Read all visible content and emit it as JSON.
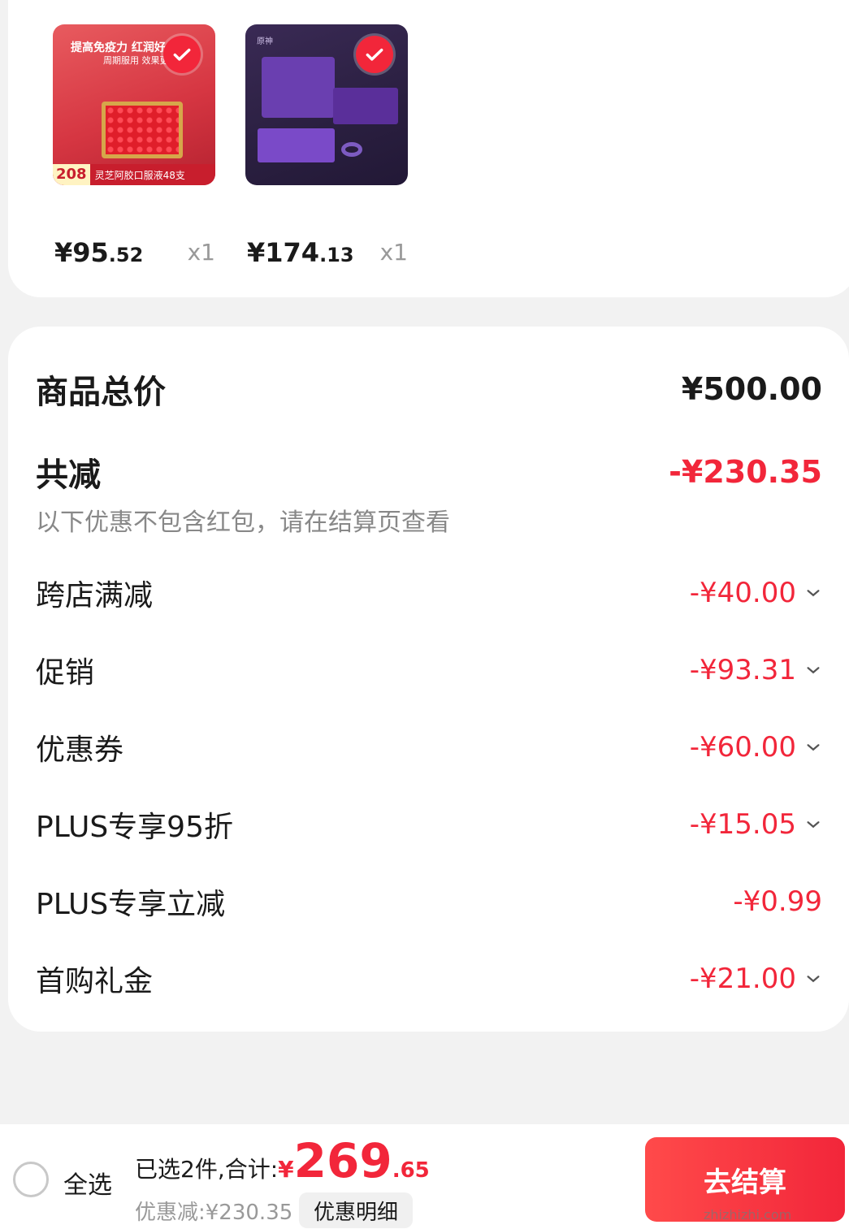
{
  "products": [
    {
      "thumb_head": "提高免疫力 红润好",
      "thumb_sub": "周期服用 效果更佳",
      "thumb_price_tag": "208",
      "thumb_desc": "灵芝阿胶口服液48支",
      "price_int": "¥95",
      "price_dec": ".52",
      "qty": "x1"
    },
    {
      "thumb_logo": "原神",
      "price_int": "¥174",
      "price_dec": ".13",
      "qty": "x1"
    }
  ],
  "summary": {
    "total_label": "商品总价",
    "total_value": "¥500.00",
    "reduce_label": "共减",
    "reduce_value": "-¥230.35",
    "note": "以下优惠不包含红包，请在结算页查看",
    "items": [
      {
        "label": "跨店满减",
        "value": "-¥40.00"
      },
      {
        "label": "促销",
        "value": "-¥93.31"
      },
      {
        "label": "优惠券",
        "value": "-¥60.00"
      },
      {
        "label": "PLUS专享95折",
        "value": "-¥15.05"
      },
      {
        "label": "PLUS专享立减",
        "value": "-¥0.99"
      },
      {
        "label": "首购礼金",
        "value": "-¥21.00"
      }
    ]
  },
  "bottom": {
    "select_all": "全选",
    "selected_text": "已选2件,合计:",
    "currency": "¥",
    "total_int": "269",
    "total_dec": ".65",
    "discount_text": "优惠减:¥230.35",
    "detail_button": "优惠明细",
    "checkout_button": "去结算"
  },
  "watermark": "zhizhizhi.com",
  "colors": {
    "accent": "#f2263a",
    "muted": "#999999"
  }
}
